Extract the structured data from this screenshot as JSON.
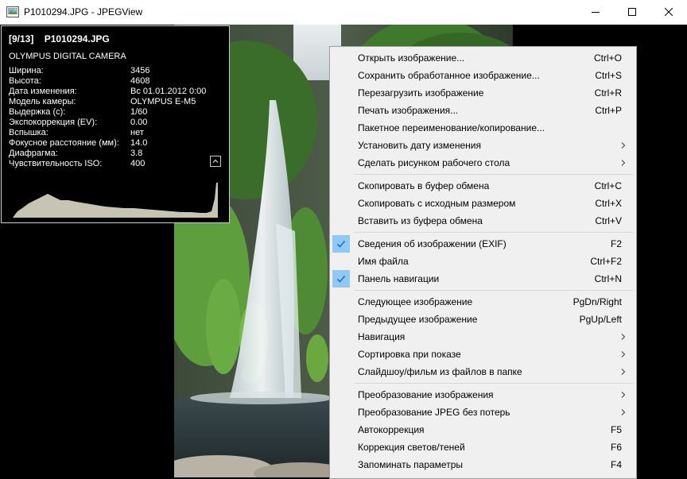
{
  "window": {
    "title": "P1010294.JPG - JPEGView",
    "icons": {
      "app": "picture-icon",
      "minimize": "minimize-icon",
      "maximize": "maximize-icon",
      "close": "close-icon"
    }
  },
  "exif": {
    "index": "[9/13]",
    "filename": "P1010294.JPG",
    "description": "OLYMPUS DIGITAL CAMERA",
    "rows": [
      {
        "key": "Ширина:",
        "value": "3456"
      },
      {
        "key": "Высота:",
        "value": "4608"
      },
      {
        "key": "Дата изменения:",
        "value": "Вс 01.01.2012 0:00"
      },
      {
        "key": "Модель камеры:",
        "value": "OLYMPUS E-M5"
      },
      {
        "key": "Выдержка (с):",
        "value": "1/60"
      },
      {
        "key": "Экспокоррекция (EV):",
        "value": "0.00"
      },
      {
        "key": "Вспышка:",
        "value": "нет"
      },
      {
        "key": "Фокусное расстояние (мм):",
        "value": "14.0"
      },
      {
        "key": "Диафрагма:",
        "value": "3.8"
      },
      {
        "key": "Чувствительность ISO:",
        "value": "400"
      }
    ],
    "icons": {
      "collapse": "chevron-up-icon"
    }
  },
  "menu": {
    "groups": [
      [
        {
          "label": "Открыть изображение...",
          "shortcut": "Ctrl+O"
        },
        {
          "label": "Сохранить обработанное изображение...",
          "shortcut": "Ctrl+S"
        },
        {
          "label": "Перезагрузить изображение",
          "shortcut": "Ctrl+R"
        },
        {
          "label": "Печать изображения...",
          "shortcut": "Ctrl+P"
        },
        {
          "label": "Пакетное переименование/копирование...",
          "shortcut": ""
        },
        {
          "label": "Установить дату изменения",
          "shortcut": "",
          "submenu": true
        },
        {
          "label": "Сделать рисунком рабочего стола",
          "shortcut": "",
          "submenu": true
        }
      ],
      [
        {
          "label": "Скопировать в буфер обмена",
          "shortcut": "Ctrl+C"
        },
        {
          "label": "Скопировать с исходным размером",
          "shortcut": "Ctrl+X"
        },
        {
          "label": "Вставить из буфера обмена",
          "shortcut": "Ctrl+V"
        }
      ],
      [
        {
          "label": "Сведения об изображении (EXIF)",
          "shortcut": "F2",
          "checked": true
        },
        {
          "label": "Имя файла",
          "shortcut": "Ctrl+F2"
        },
        {
          "label": "Панель навигации",
          "shortcut": "Ctrl+N",
          "checked": true
        }
      ],
      [
        {
          "label": "Следующее изображение",
          "shortcut": "PgDn/Right"
        },
        {
          "label": "Предыдущее изображение",
          "shortcut": "PgUp/Left"
        },
        {
          "label": "Навигация",
          "shortcut": "",
          "submenu": true
        },
        {
          "label": "Сортировка при показе",
          "shortcut": "",
          "submenu": true
        },
        {
          "label": "Слайдшоу/фильм из файлов в папке",
          "shortcut": "",
          "submenu": true
        }
      ],
      [
        {
          "label": "Преобразование изображения",
          "shortcut": "",
          "submenu": true
        },
        {
          "label": "Преобразование JPEG без потерь",
          "shortcut": "",
          "submenu": true
        },
        {
          "label": "Автокоррекция",
          "shortcut": "F5"
        },
        {
          "label": "Коррекция светов/теней",
          "shortcut": "F6"
        },
        {
          "label": "Запоминать параметры",
          "shortcut": "F4"
        }
      ]
    ],
    "colors": {
      "check_highlight": "#90c8f6",
      "check_mark": "#1a73c9"
    }
  }
}
